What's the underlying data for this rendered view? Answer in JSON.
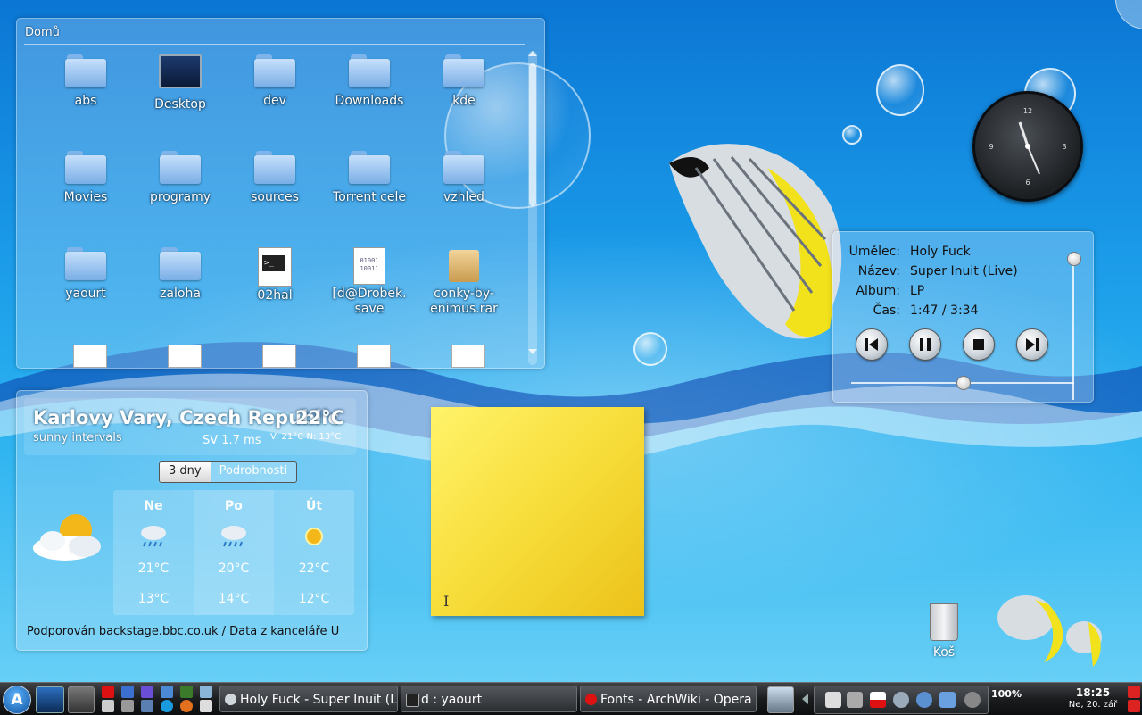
{
  "folderview": {
    "title": "Domů",
    "items": [
      {
        "label": "abs",
        "icon": "folder-icon"
      },
      {
        "label": "Desktop",
        "icon": "desktop-icon"
      },
      {
        "label": "dev",
        "icon": "folder-icon"
      },
      {
        "label": "Downloads",
        "icon": "folder-icon"
      },
      {
        "label": "kde",
        "icon": "folder-icon"
      },
      {
        "label": "Movies",
        "icon": "folder-icon"
      },
      {
        "label": "programy",
        "icon": "folder-icon"
      },
      {
        "label": "sources",
        "icon": "folder-icon"
      },
      {
        "label": "Torrent cele",
        "icon": "folder-icon"
      },
      {
        "label": "vzhled",
        "icon": "folder-icon"
      },
      {
        "label": "yaourt",
        "icon": "folder-icon"
      },
      {
        "label": "zaloha",
        "icon": "folder-icon"
      },
      {
        "label": "02hal",
        "icon": "terminal-script-icon"
      },
      {
        "label": "[d@Drobek. save",
        "icon": "binary-file-icon"
      },
      {
        "label": "conky-by-enimus.rar",
        "icon": "archive-icon"
      }
    ],
    "binary_glyph": "01001\n10011"
  },
  "weather": {
    "city": "Karlovy Vary, Czech Republic",
    "current_temp": "22°C",
    "condition": "sunny intervals",
    "wind": "SV 1.7 ms",
    "high_low": "V: 21°C N: 13°C",
    "tabs": [
      "3 dny",
      "Podrobnosti"
    ],
    "forecast": [
      {
        "day": "Ne",
        "high": "21°C",
        "low": "13°C",
        "icon": "rain-cloud-icon"
      },
      {
        "day": "Po",
        "high": "20°C",
        "low": "14°C",
        "icon": "rain-cloud-icon"
      },
      {
        "day": "Út",
        "high": "22°C",
        "low": "12°C",
        "icon": "sun-icon"
      }
    ],
    "credit": "Podporován backstage.bbc.co.uk / Data z kanceláře U"
  },
  "note": {
    "cursor": "I"
  },
  "player": {
    "fields": [
      {
        "key": "Umělec:",
        "value": "Holy Fuck"
      },
      {
        "key": "Název:",
        "value": "Super Inuit (Live)"
      },
      {
        "key": "Album:",
        "value": "LP"
      },
      {
        "key": "Čas:",
        "value": "1:47 / 3:34"
      }
    ],
    "progress": 0.5
  },
  "clock_widget": {
    "numbers": [
      "12",
      "3",
      "6",
      "9"
    ]
  },
  "trash": {
    "label": "Koš"
  },
  "taskbar": {
    "launcher_label": "A",
    "tasks": [
      {
        "label": "Holy Fuck - Super Inuit (Live)",
        "icon": "media-player-icon"
      },
      {
        "label": "d : yaourt",
        "icon": "terminal-icon"
      },
      {
        "label": "Fonts - ArchWiki - Opera",
        "icon": "opera-icon"
      }
    ],
    "battery": "100%",
    "time": "18:25",
    "date": "Ne, 20. zář"
  },
  "colors": {
    "accent": "#1a9ae8",
    "panel": "#1a1c1e",
    "note": "#f7dd3a"
  }
}
